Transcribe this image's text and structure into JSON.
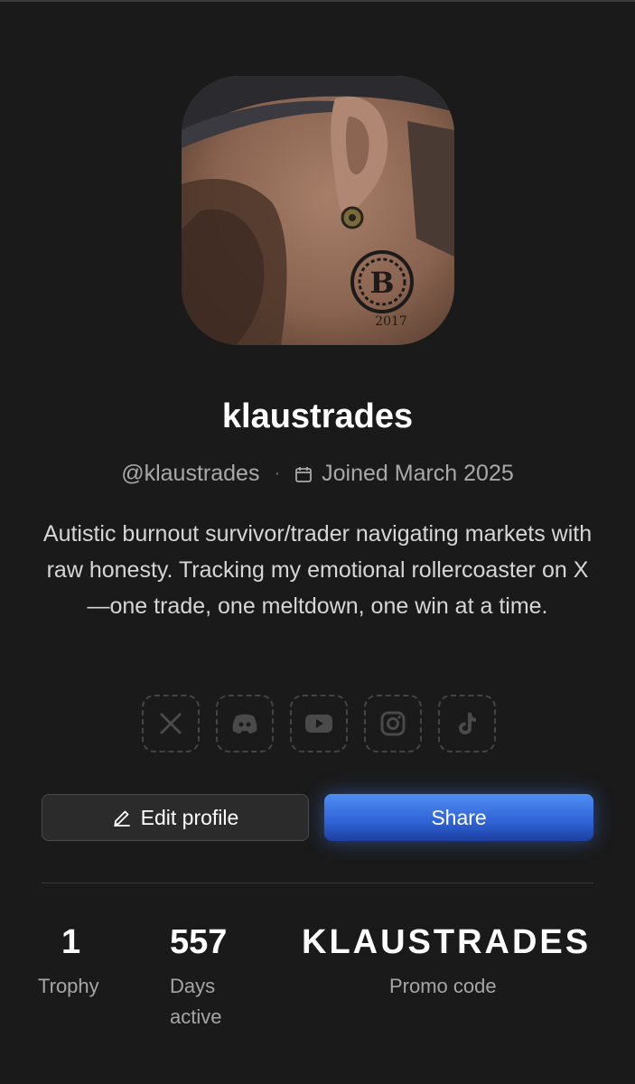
{
  "profile": {
    "username": "klaustrades",
    "handle": "@klaustrades",
    "joined": "Joined March 2025",
    "bio": "Autistic burnout survivor/trader navigating markets with raw honesty. Tracking my emotional rollercoaster on X—one trade, one meltdown, one win at a time.",
    "avatar_tattoo_year": "2017"
  },
  "socials": [
    {
      "icon": "x-icon"
    },
    {
      "icon": "discord-icon"
    },
    {
      "icon": "youtube-icon"
    },
    {
      "icon": "instagram-icon"
    },
    {
      "icon": "tiktok-icon"
    }
  ],
  "actions": {
    "edit_label": "Edit profile",
    "share_label": "Share"
  },
  "stats": {
    "trophy_value": "1",
    "trophy_label": "Trophy",
    "days_value": "557",
    "days_label_1": "Days",
    "days_label_2": "active",
    "promo_value": "KLAUSTRADES",
    "promo_label": "Promo code"
  },
  "colors": {
    "background": "#1a1a1a",
    "share_button": "#3b74e6",
    "muted_text": "#a9a9a9"
  }
}
